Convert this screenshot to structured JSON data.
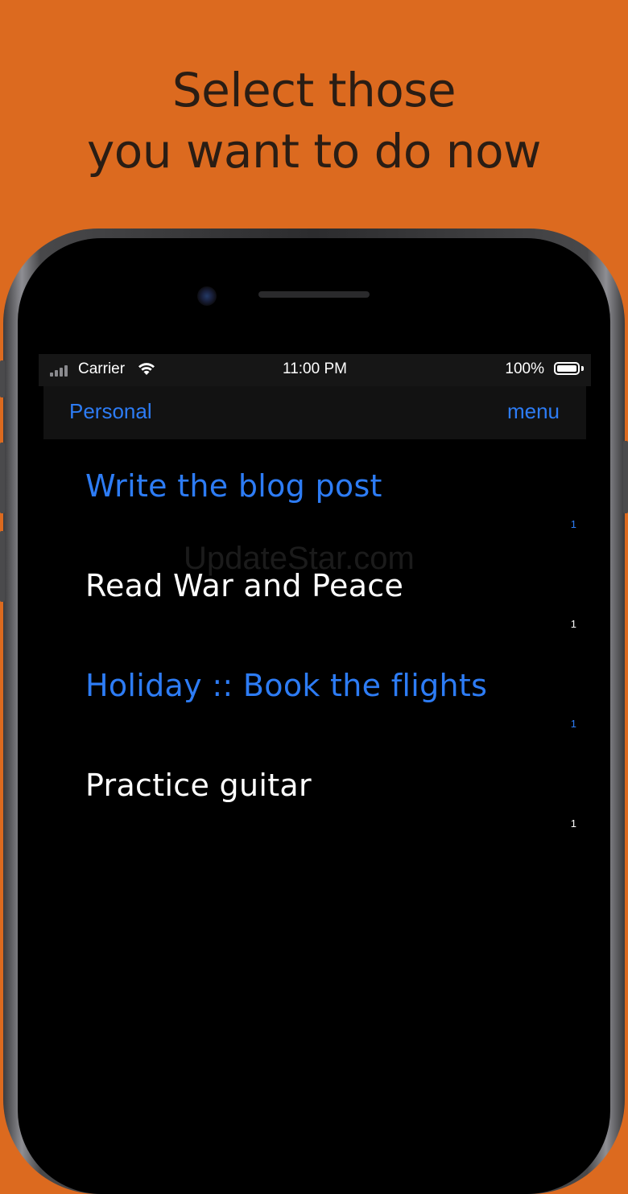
{
  "headline": {
    "line1": "Select those",
    "line2": "you want to do now"
  },
  "status_bar": {
    "carrier": "Carrier",
    "time": "11:00 PM",
    "battery": "100%"
  },
  "nav_bar": {
    "left": "Personal",
    "right": "menu"
  },
  "tasks": [
    {
      "title": "Write the blog post",
      "count": "1",
      "state": "active"
    },
    {
      "title": "Read War and Peace",
      "count": "1",
      "state": "normal"
    },
    {
      "title": "Holiday :: Book the flights",
      "count": "1",
      "state": "active"
    },
    {
      "title": "Practice guitar",
      "count": "1",
      "state": "normal"
    }
  ],
  "watermark": "UpdateStar.com",
  "colors": {
    "background": "#DC6A1F",
    "accent": "#2D7CF5",
    "screen": "#000000"
  }
}
